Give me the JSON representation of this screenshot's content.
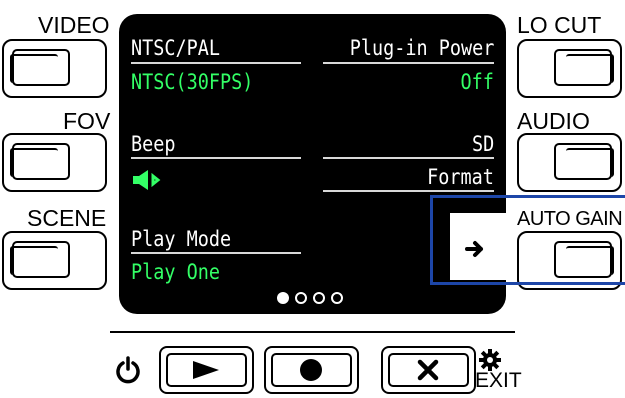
{
  "left_buttons": [
    {
      "label": "VIDEO"
    },
    {
      "label": "FOV"
    },
    {
      "label": "SCENE"
    }
  ],
  "right_buttons": [
    {
      "label": "LO CUT"
    },
    {
      "label": "AUDIO"
    },
    {
      "label": "AUTO GAIN"
    }
  ],
  "screen": {
    "ntsc_pal": {
      "label": "NTSC/PAL",
      "value": "NTSC(30FPS)"
    },
    "plugin_power": {
      "label": "Plug-in Power",
      "value": "Off"
    },
    "beep": {
      "label": "Beep",
      "value_icon": "speaker-icon"
    },
    "sd_format": {
      "label_line1": "SD",
      "label_line2": "Format"
    },
    "play_mode": {
      "label": "Play Mode",
      "value": "Play One"
    },
    "next_page_icon": "arrow-right-icon",
    "pages": {
      "current": 1,
      "total": 4
    }
  },
  "bottom_controls": {
    "power_icon": "power-icon",
    "play_icon": "play-icon",
    "record_icon": "record-icon",
    "close_icon": "close-icon",
    "settings_icon": "gear-icon",
    "exit_label": "EXIT"
  },
  "colors": {
    "lcd_value": "#33ff66",
    "highlight": "#1d46a8"
  }
}
